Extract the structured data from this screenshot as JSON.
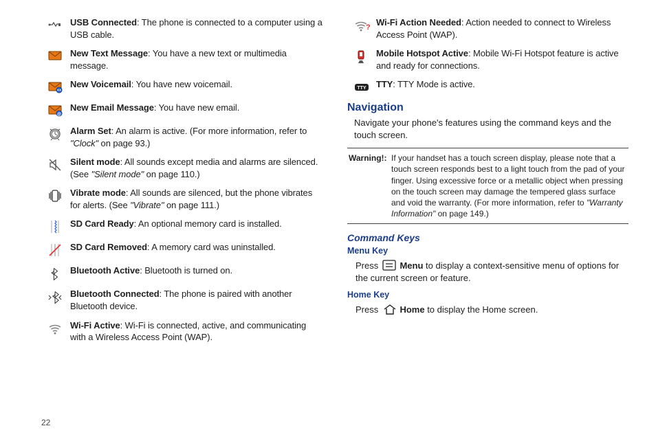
{
  "page_number": "22",
  "left": [
    {
      "icon": "usb",
      "title": "USB Connected",
      "rest": ": The phone is connected to a computer using a USB cable."
    },
    {
      "icon": "envelope",
      "title": "New Text Message",
      "rest": ": You have a new text or multimedia message."
    },
    {
      "icon": "env-tape",
      "title": "New Voicemail",
      "rest": ": You have new voicemail."
    },
    {
      "icon": "env-at",
      "title": "New Email Message",
      "rest": ": You have new email."
    },
    {
      "icon": "alarm",
      "title": "Alarm Set",
      "rest": ": An alarm is active. (For more information, refer to ",
      "ital": "\"Clock\"",
      "rest2": " on page 93.)"
    },
    {
      "icon": "silent",
      "title": "Silent mode",
      "rest": ": All sounds except media and alarms are silenced. (See ",
      "ital": "\"Silent mode\"",
      "rest2": " on page 110.)"
    },
    {
      "icon": "vibrate",
      "title": "Vibrate mode",
      "rest": ": All sounds are silenced, but the phone vibrates for alerts. (See ",
      "ital": "\"Vibrate\"",
      "rest2": " on page 111.)"
    },
    {
      "icon": "sd-in",
      "title": "SD Card Ready",
      "rest": ": An optional memory card is installed."
    },
    {
      "icon": "sd-out",
      "title": "SD Card Removed",
      "rest": ": A memory card was uninstalled."
    },
    {
      "icon": "bt",
      "title": "Bluetooth Active",
      "rest": ": Bluetooth is turned on."
    },
    {
      "icon": "bt-conn",
      "title": "Bluetooth Connected",
      "rest": ": The phone is paired with another Bluetooth device."
    },
    {
      "icon": "wifi",
      "title": "Wi-Fi Active",
      "rest": ": Wi-Fi is connected, active, and communicating with a Wireless Access Point (WAP)."
    }
  ],
  "right": [
    {
      "icon": "wifi-q",
      "title": "Wi-Fi Action Needed",
      "rest": ": Action needed to connect to Wireless Access Point (WAP)."
    },
    {
      "icon": "hotspot",
      "title": "Mobile Hotspot Active",
      "rest": ": Mobile Wi-Fi Hotspot feature is active and ready for connections."
    },
    {
      "icon": "tty",
      "title": "TTY",
      "rest": ": TTY Mode is active."
    }
  ],
  "nav_heading": "Navigation",
  "nav_text": "Navigate your phone's features using the command keys and the touch screen.",
  "warning_label": "Warning!:",
  "warning_body_a": "If your handset has a touch screen display, please note that a touch screen responds best to a light touch from the pad of your finger. Using excessive force or a metallic object when pressing on the touch screen may damage the tempered glass surface and void the warranty. (For more information, refer to ",
  "warning_ital": "\"Warranty Information\"",
  "warning_body_b": " on page 149.)",
  "cmd_heading": "Command Keys",
  "menu_key_heading": "Menu Key",
  "menu_key_pre": "Press ",
  "menu_key_bold": " Menu",
  "menu_key_post": " to display a context-sensitive menu of options for the current screen or feature.",
  "home_key_heading": "Home Key",
  "home_key_pre": "Press ",
  "home_key_bold": " Home",
  "home_key_post": " to display the Home screen."
}
